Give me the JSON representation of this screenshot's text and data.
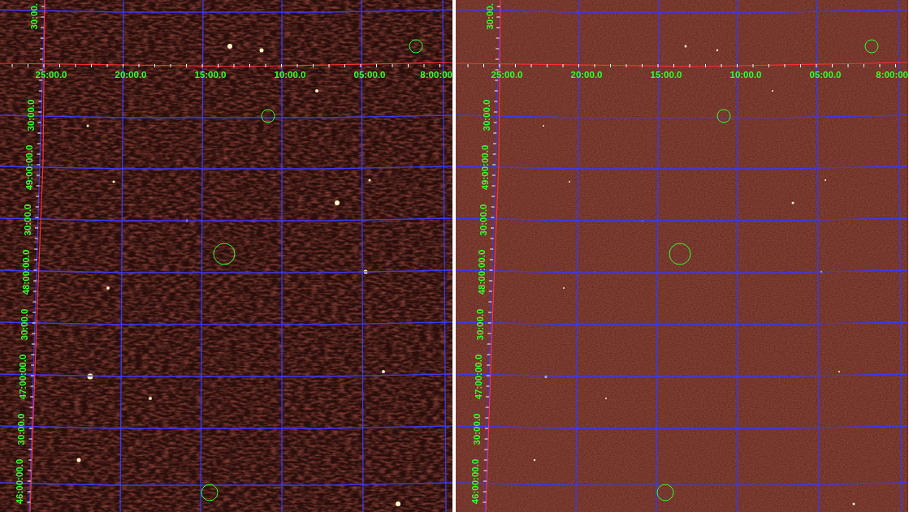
{
  "panels": [
    {
      "kind": "noisy",
      "x_labels": [
        "25:00.0",
        "20:00.0",
        "15:00.0",
        "10:00.0",
        "05:00.0",
        "8:00:00"
      ],
      "top_y_label": "30:00.",
      "y_labels": [
        "30:00.0",
        "49:00:00.0",
        "30:00.0",
        "48:00:00.0",
        "30:00.0",
        "47:00:00.0",
        "30:00.0",
        "46:00:00.0"
      ]
    },
    {
      "kind": "clean",
      "x_labels": [
        "25:00.0",
        "20:00.0",
        "15:00.0",
        "10:00.0",
        "05:00.0",
        "8:00:00"
      ],
      "top_y_label": "30:00.",
      "y_labels": [
        "30:00.0",
        "49:00:00.0",
        "30:00.0",
        "48:00:00.0",
        "30:00.0",
        "47:00:00.0",
        "30:00.0",
        "46:00:00.0"
      ]
    }
  ]
}
